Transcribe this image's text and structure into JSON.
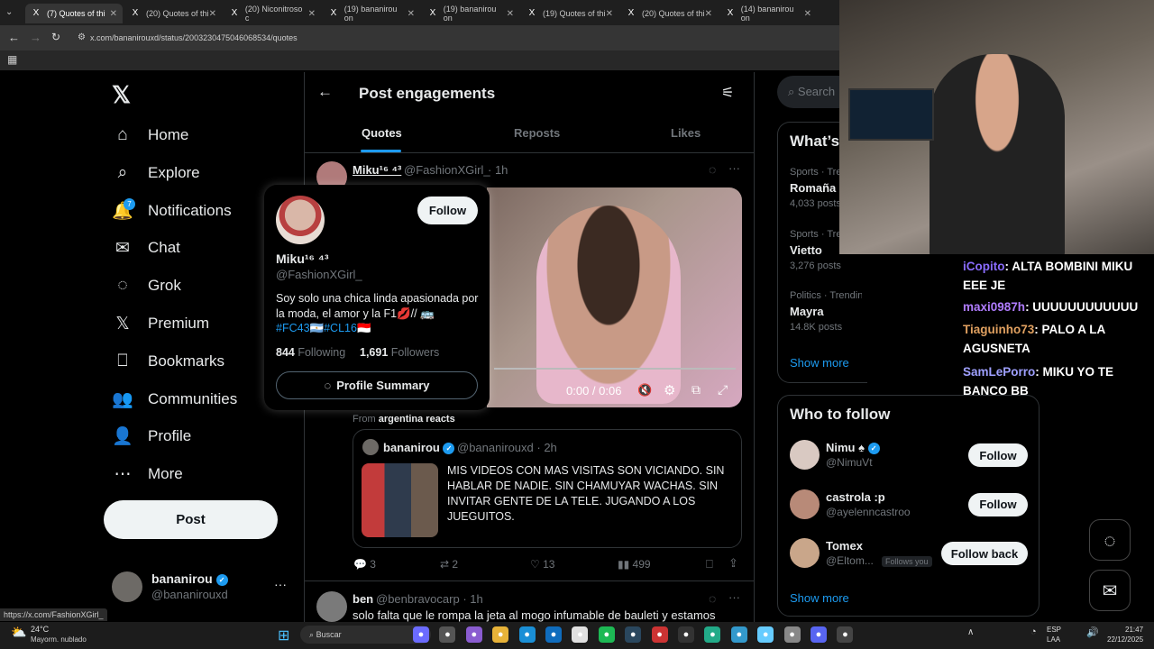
{
  "browser": {
    "tabs": [
      "(7) Quotes of thi",
      "(20) Quotes of thi",
      "(20) Niconitroso c",
      "(19) bananirou on",
      "(19) bananirou on",
      "(19) Quotes of thi",
      "(20) Quotes of thi",
      "(14) bananirou on"
    ],
    "url": "x.com/bananirouxd/status/2003230475046068534/quotes",
    "status_url": "https://x.com/FashionXGirl_"
  },
  "nav": {
    "items": [
      "Home",
      "Explore",
      "Notifications",
      "Chat",
      "Grok",
      "Premium",
      "Bookmarks",
      "Communities",
      "Profile",
      "More"
    ],
    "badge": "7",
    "post_label": "Post"
  },
  "account": {
    "name": "bananirou",
    "handle": "@bananirouxd",
    "more": "···"
  },
  "header": {
    "title": "Post engagements",
    "tabs": [
      "Quotes",
      "Reposts",
      "Likes"
    ]
  },
  "post1": {
    "name": "Miku¹⁶ ⁴³",
    "handle": "@FashionXGirl_",
    "time": "· 1h",
    "video_time": "0:00 / 0:06",
    "from_label": "From",
    "from_source": "argentina reacts",
    "quoted": {
      "name": "bananirou",
      "handle": "@bananirouxd",
      "time": "· 2h",
      "text": "MIS VIDEOS CON MAS VISITAS SON VICIANDO. SIN HABLAR DE NADIE. SIN CHAMUYAR WACHAS. SIN INVITAR GENTE DE LA TELE. JUGANDO A LOS JUEGUITOS."
    },
    "replies": "3",
    "reposts": "2",
    "likes": "13",
    "views": "499"
  },
  "post2": {
    "name": "ben",
    "handle": "@benbravocarp",
    "time": "· 1h",
    "text": "solo falta que le rompa la jeta al mogo infumable de bauleti y estamos"
  },
  "hovercard": {
    "name": "Miku¹⁶ ⁴³",
    "handle": "@FashionXGirl_",
    "follow": "Follow",
    "bio": "Soy solo una chica linda apasionada por la moda, el amor y la F1💋// 🚌",
    "tags": [
      "#FC43",
      "🇦🇷",
      "#CL16",
      "🇮🇩"
    ],
    "following_count": "844",
    "following_label": "Following",
    "followers_count": "1,691",
    "followers_label": "Followers",
    "summary": "Profile Summary"
  },
  "search": {
    "placeholder": "Search"
  },
  "trends": {
    "title": "What’s",
    "items": [
      {
        "meta": "Sports · Tre",
        "name": "Romaña",
        "count": "4,033 posts"
      },
      {
        "meta": "Sports · Tre",
        "name": "Vietto",
        "count": "3,276 posts"
      },
      {
        "meta": "Politics · Trending",
        "name": "Mayra",
        "count": "14.8K posts"
      }
    ],
    "show_more": "Show more"
  },
  "who": {
    "title": "Who to follow",
    "users": [
      {
        "name": "Nimu ♠",
        "handle": "@NimuVt",
        "btn": "Follow",
        "tag": ""
      },
      {
        "name": "castrola :p",
        "handle": "@ayelenncastroo",
        "btn": "Follow",
        "tag": ""
      },
      {
        "name": "Tomex",
        "handle": "@Eltom...",
        "btn": "Follow back",
        "tag": "Follows you"
      }
    ],
    "show_more": "Show more"
  },
  "chat": [
    {
      "user": "iCopito",
      "msg": ": ALTA BOMBINI MIKU EEE JE",
      "color": "#8a6cff"
    },
    {
      "user": "maxi0987h",
      "msg": ": UUUUUUUUUUUU",
      "color": "#b07cff"
    },
    {
      "user": "Tiaguinho73",
      "msg": ": PALO A LA AGUSNETA",
      "color": "#e0a060"
    },
    {
      "user": "SamLePorro",
      "msg": ": MIKU YO TE BANCO BB",
      "color": "#9fa0ff"
    }
  ],
  "taskbar": {
    "weather_temp": "24°C",
    "weather_desc": "Mayorm. nublado",
    "search": "Buscar",
    "lang1": "ESP",
    "lang2": "LAA",
    "time": "21:47",
    "date": "22/12/2025"
  },
  "colors": {
    "accent": "#1d9bf0",
    "bg": "#000000",
    "border": "#2f3336"
  }
}
